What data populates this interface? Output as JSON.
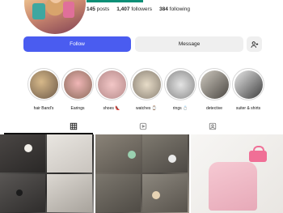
{
  "profile": {
    "stats": {
      "posts_value": "145",
      "posts_label": "posts",
      "followers_value": "1,407",
      "followers_label": "followers",
      "following_value": "384",
      "following_label": "following"
    }
  },
  "actions": {
    "follow_label": "Follow",
    "message_label": "Message",
    "suggest_icon": "add-person-icon"
  },
  "highlights": [
    {
      "label": "hair Band's"
    },
    {
      "label": "Earings"
    },
    {
      "label": "shoes 👠"
    },
    {
      "label": "watches ⌚"
    },
    {
      "label": "rings 💍"
    },
    {
      "label": "detective"
    },
    {
      "label": "suiter & shirts"
    }
  ],
  "tabs": [
    {
      "name": "grid",
      "icon": "grid-icon",
      "active": true
    },
    {
      "name": "reels",
      "icon": "reels-icon",
      "active": false
    },
    {
      "name": "tagged",
      "icon": "tagged-icon",
      "active": false
    }
  ],
  "colors": {
    "follow_button": "#4a5cf0",
    "message_button": "#efefef"
  }
}
